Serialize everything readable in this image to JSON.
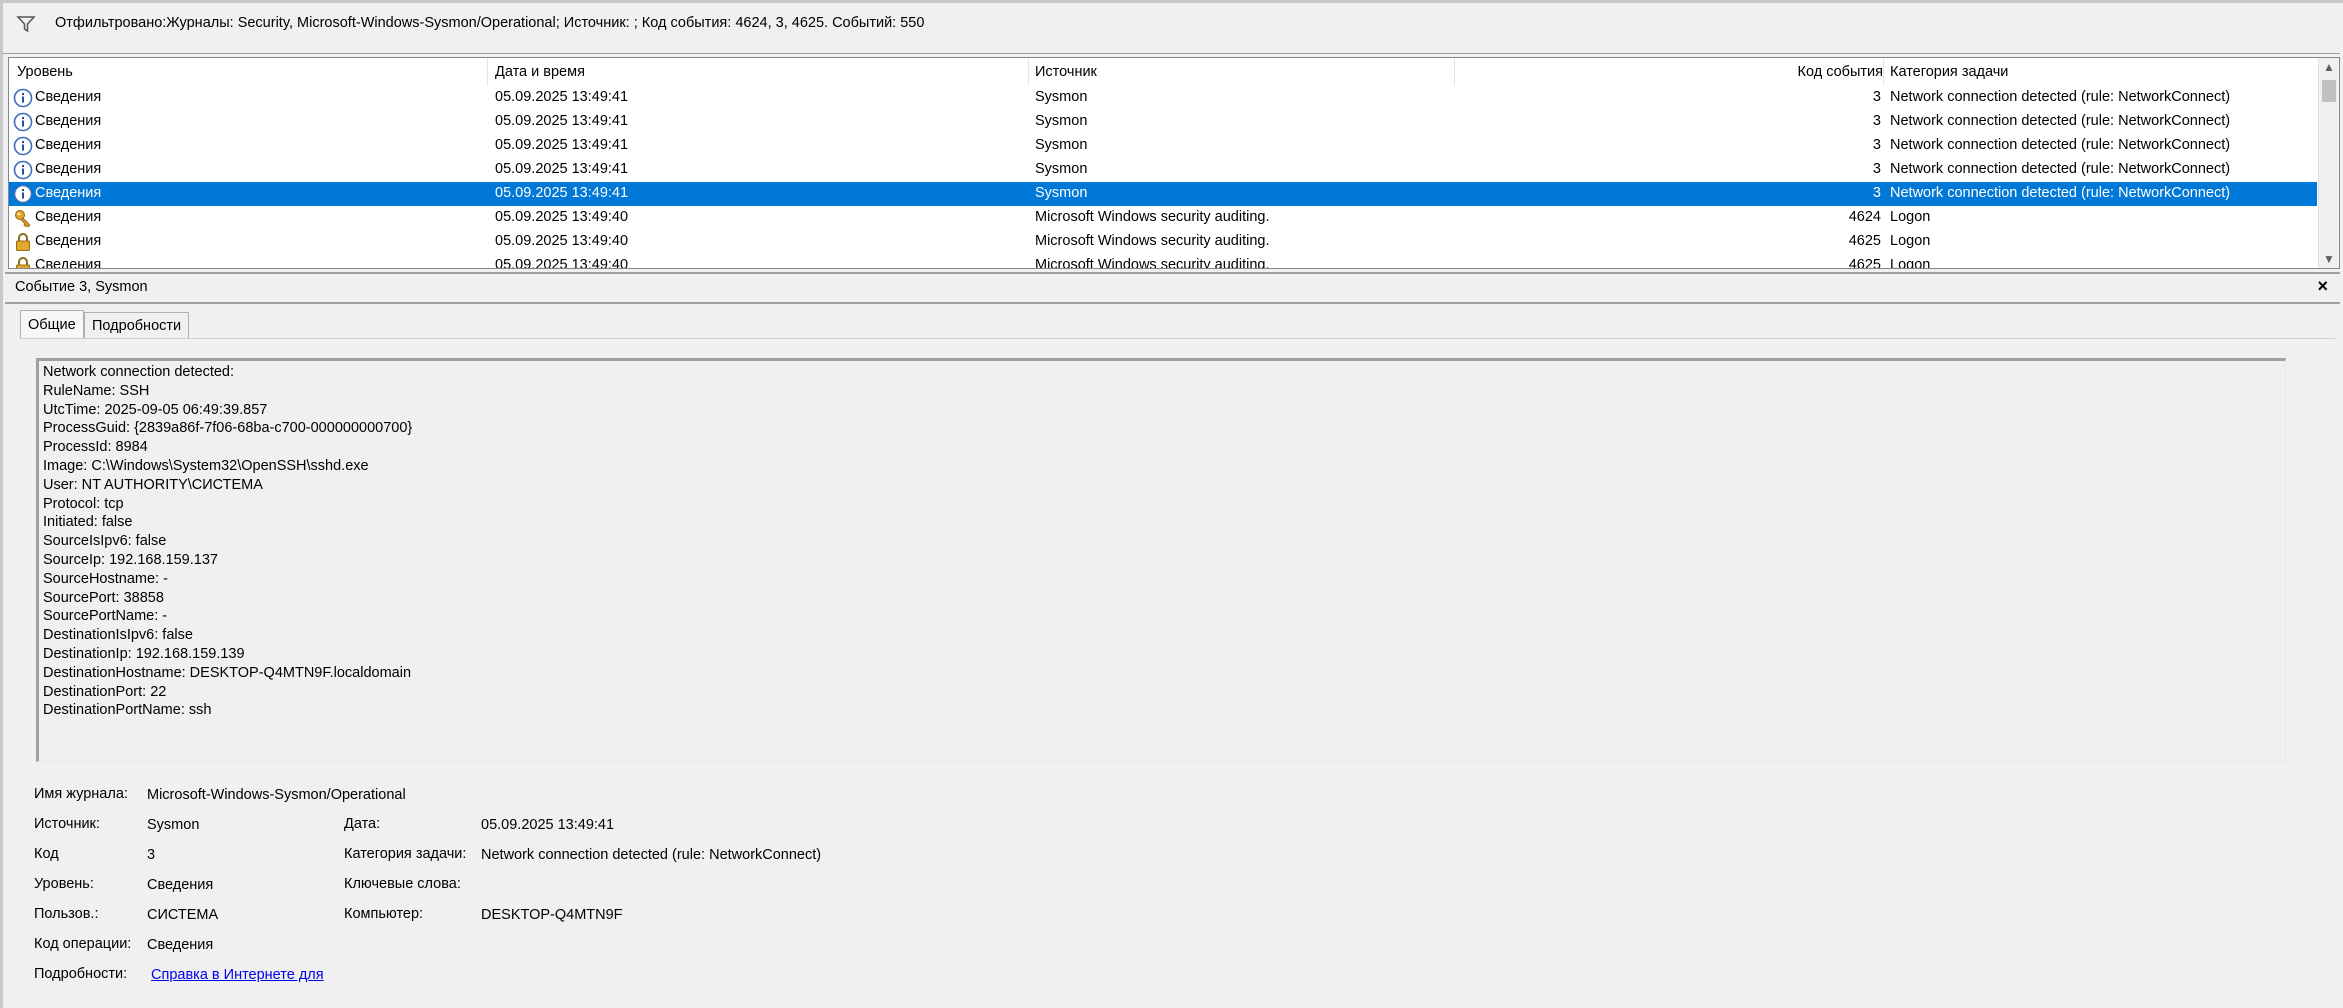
{
  "filter": {
    "icon": "filter-icon",
    "text": "Отфильтровано:Журналы: Security, Microsoft-Windows-Sysmon/Operational; Источник: ; Код события: 4624, 3, 4625. Событий: 550"
  },
  "columns": {
    "level": "Уровень",
    "datetime": "Дата и время",
    "source": "Источник",
    "event_id": "Код события",
    "category": "Категория задачи"
  },
  "rows": [
    {
      "icon": "info-icon",
      "level": "Сведения",
      "datetime": "05.09.2025 13:49:41",
      "source": "Sysmon",
      "event_id": "3",
      "category": "Network connection detected (rule: NetworkConnect)"
    },
    {
      "icon": "info-icon",
      "level": "Сведения",
      "datetime": "05.09.2025 13:49:41",
      "source": "Sysmon",
      "event_id": "3",
      "category": "Network connection detected (rule: NetworkConnect)"
    },
    {
      "icon": "info-icon",
      "level": "Сведения",
      "datetime": "05.09.2025 13:49:41",
      "source": "Sysmon",
      "event_id": "3",
      "category": "Network connection detected (rule: NetworkConnect)"
    },
    {
      "icon": "info-icon",
      "level": "Сведения",
      "datetime": "05.09.2025 13:49:41",
      "source": "Sysmon",
      "event_id": "3",
      "category": "Network connection detected (rule: NetworkConnect)"
    },
    {
      "icon": "info-icon",
      "level": "Сведения",
      "datetime": "05.09.2025 13:49:41",
      "source": "Sysmon",
      "event_id": "3",
      "category": "Network connection detected (rule: NetworkConnect)",
      "selected": true
    },
    {
      "icon": "key-icon",
      "level": "Сведения",
      "datetime": "05.09.2025 13:49:40",
      "source": "Microsoft Windows security auditing.",
      "event_id": "4624",
      "category": "Logon"
    },
    {
      "icon": "lock-icon",
      "level": "Сведения",
      "datetime": "05.09.2025 13:49:40",
      "source": "Microsoft Windows security auditing.",
      "event_id": "4625",
      "category": "Logon"
    },
    {
      "icon": "lock-icon",
      "level": "Сведения",
      "datetime": "05.09.2025 13:49:40",
      "source": "Microsoft Windows security auditing.",
      "event_id": "4625",
      "category": "Logon"
    }
  ],
  "detail": {
    "title": "Событие 3, Sysmon",
    "close": "×",
    "tabs": [
      "Общие",
      "Подробности"
    ],
    "message": [
      "Network connection detected:",
      "RuleName: SSH",
      "UtcTime: 2025-09-05 06:49:39.857",
      "ProcessGuid: {2839a86f-7f06-68ba-c700-000000000700}",
      "ProcessId: 8984",
      "Image: C:\\Windows\\System32\\OpenSSH\\sshd.exe",
      "User: NT AUTHORITY\\СИСТЕМА",
      "Protocol: tcp",
      "Initiated: false",
      "SourceIsIpv6: false",
      "SourceIp: 192.168.159.137",
      "SourceHostname: -",
      "SourcePort: 38858",
      "SourcePortName: -",
      "DestinationIsIpv6: false",
      "DestinationIp: 192.168.159.139",
      "DestinationHostname: DESKTOP-Q4MTN9F.localdomain",
      "DestinationPort: 22",
      "DestinationPortName: ssh"
    ],
    "props": {
      "log_name_label": "Имя журнала:",
      "log_name": "Microsoft-Windows-Sysmon/Operational",
      "source_label": "Источник:",
      "source": "Sysmon",
      "date_label": "Дата:",
      "date": "05.09.2025 13:49:41",
      "code_label": "Код",
      "code": "3",
      "task_label": "Категория задачи:",
      "task": "Network connection detected (rule: NetworkConnect)",
      "level_label": "Уровень:",
      "level": "Сведения",
      "keywords_label": "Ключевые слова:",
      "keywords": "",
      "user_label": "Пользов.:",
      "user": "СИСТЕМА",
      "computer_label": "Компьютер:",
      "computer": "DESKTOP-Q4MTN9F",
      "opcode_label": "Код операции:",
      "opcode": "Сведения",
      "more_label": "Подробности:",
      "more_link": "Справка в Интернете для"
    }
  },
  "colors": {
    "selection": "#0078d7",
    "link": "#0000ee"
  }
}
